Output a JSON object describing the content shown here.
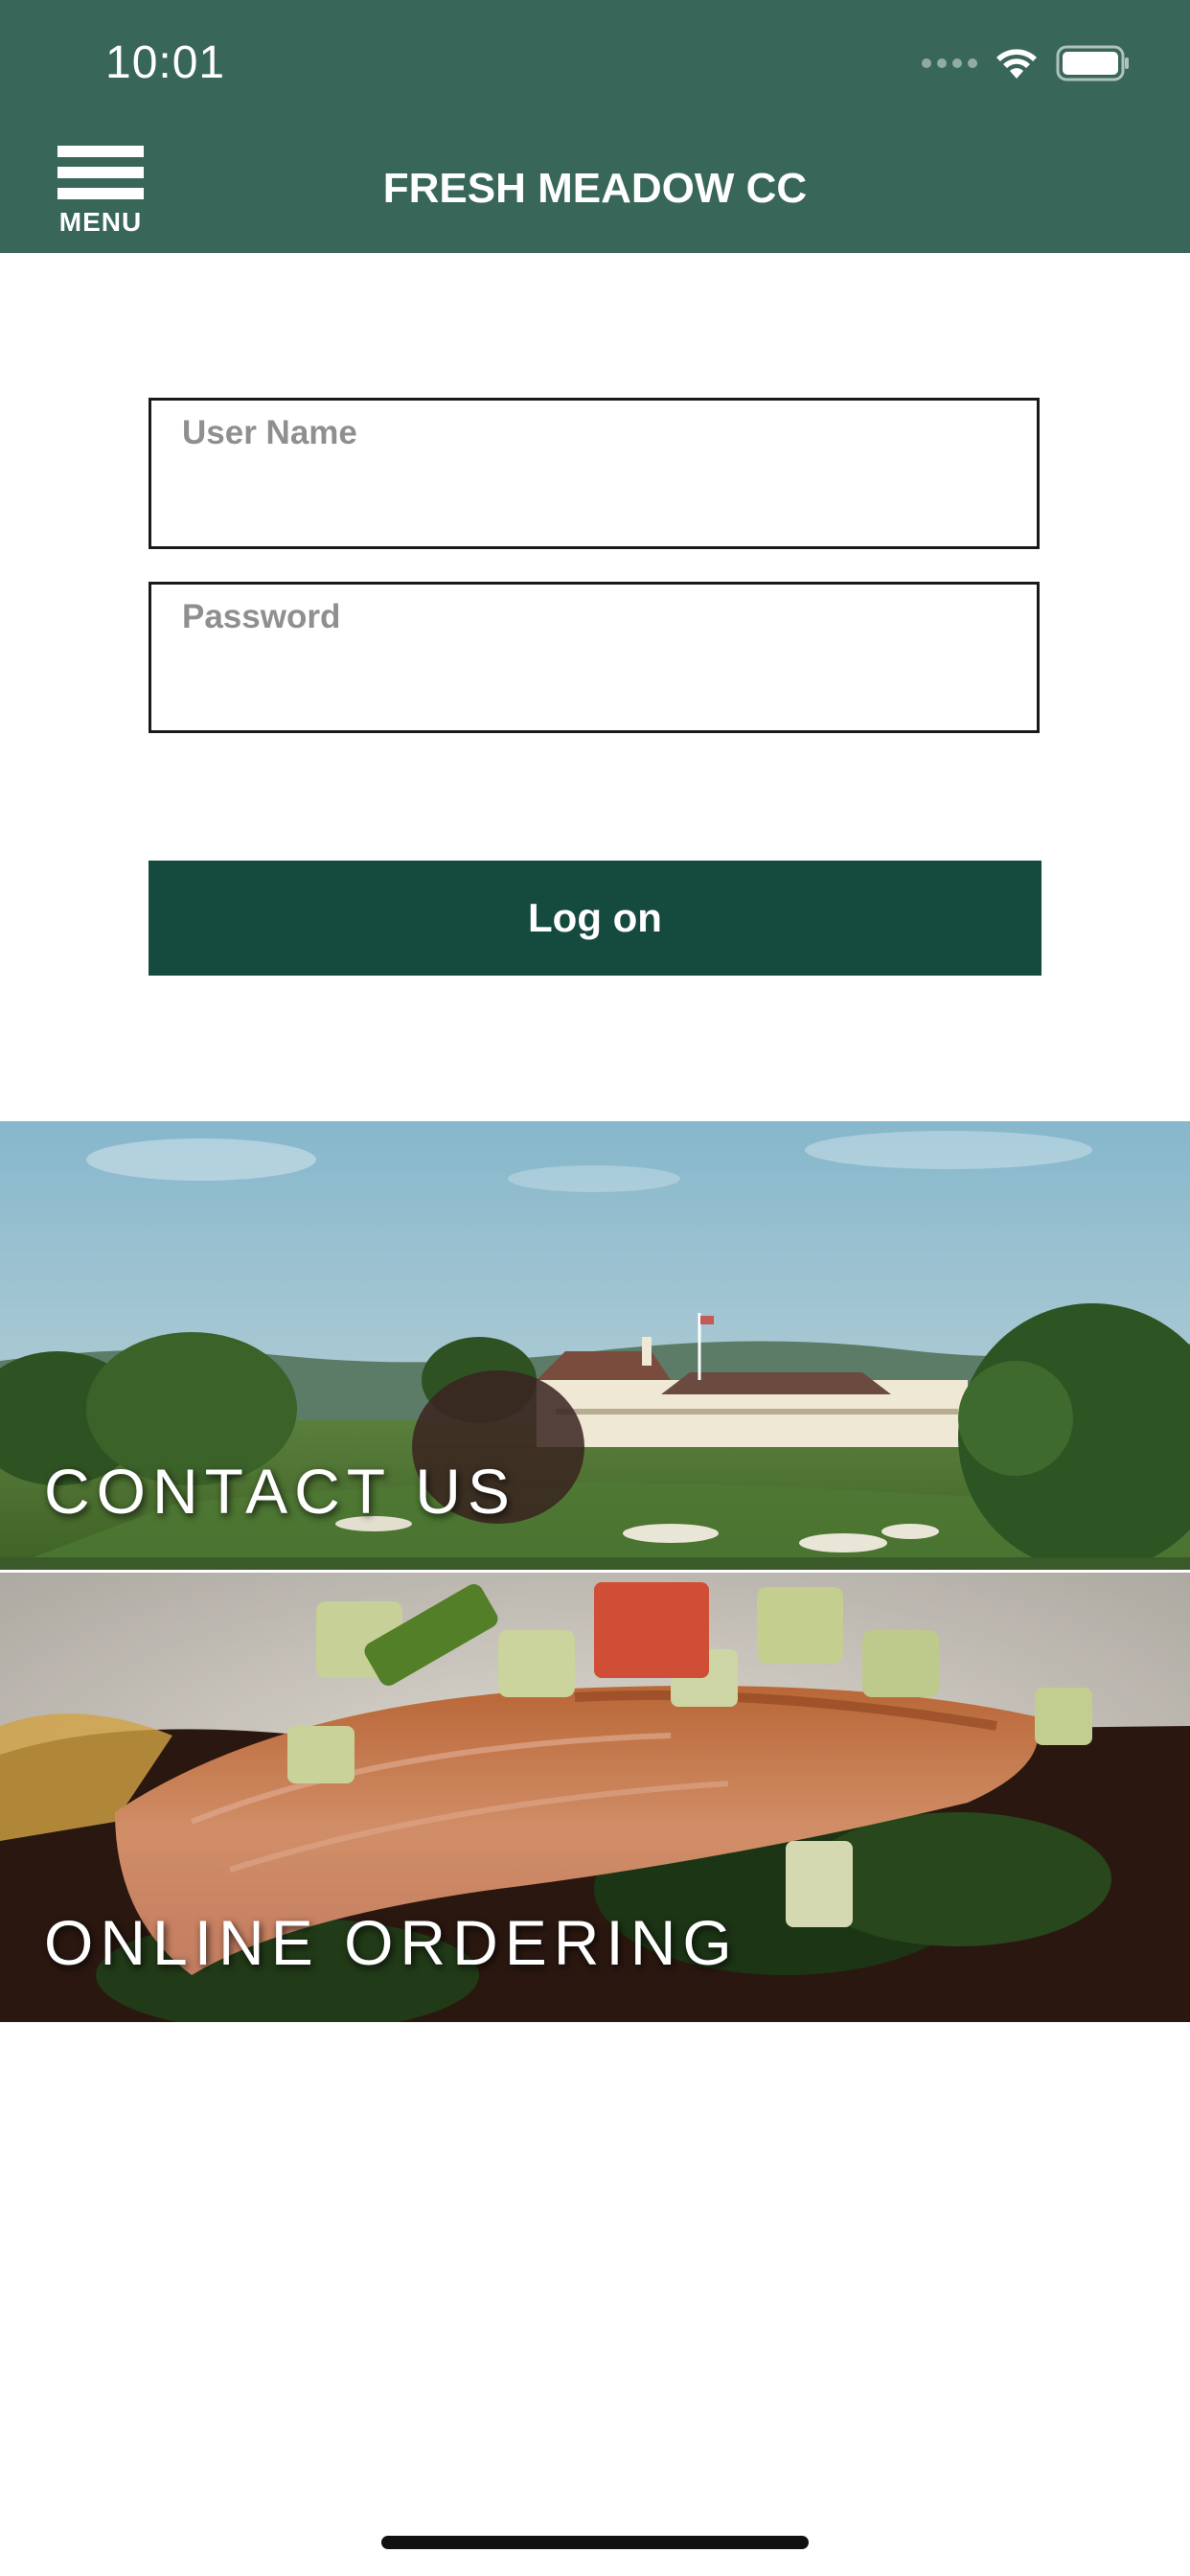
{
  "status_bar": {
    "time": "10:01"
  },
  "header": {
    "menu_label": "MENU",
    "title": "FRESH MEADOW CC",
    "background": "#38675a"
  },
  "login": {
    "username_label": "User Name",
    "password_label": "Password",
    "submit_label": "Log on",
    "button_color": "#154a3f"
  },
  "tiles": [
    {
      "label": "CONTACT US",
      "image": "golf-clubhouse-photo"
    },
    {
      "label": "ONLINE ORDERING",
      "image": "salmon-dish-photo"
    }
  ]
}
